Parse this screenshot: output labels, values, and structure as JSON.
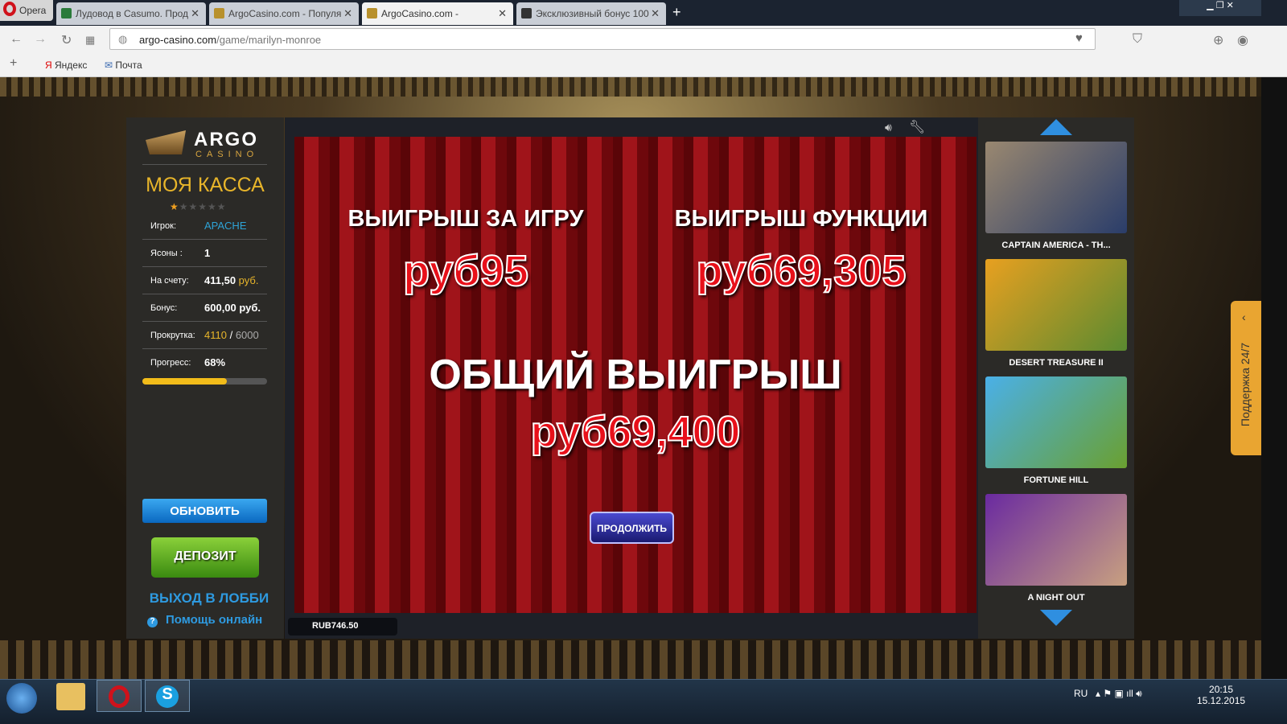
{
  "browser": {
    "opera_label": "Opera",
    "tabs": [
      {
        "title": "Лудовод в Casumo. Прод"
      },
      {
        "title": "ArgoCasino.com - Популя"
      },
      {
        "title": "ArgoCasino.com -"
      },
      {
        "title": "Эксклюзивный бонус 100"
      }
    ],
    "url_domain": "argo-casino.com",
    "url_path": "/game/marilyn-monroe",
    "bookmarks": [
      "Яндекс",
      "Почта"
    ]
  },
  "left": {
    "logo_top": "ARGO",
    "logo_bottom": "CASINO",
    "title": "МОЯ КАССА",
    "rating": 1,
    "rating_max": 6,
    "rows": [
      {
        "label": "Игрок:",
        "value": "APACHE"
      },
      {
        "label": "Ясоны :",
        "value": "1"
      },
      {
        "label": "На счету:",
        "value": "411,50",
        "unit": "руб."
      },
      {
        "label": "Бонус:",
        "value": "600,00 руб."
      },
      {
        "label": "Прокрутка:",
        "value": "4110",
        "sep": " / ",
        "total": "6000"
      },
      {
        "label": "Прогресс:",
        "value": "68%"
      }
    ],
    "progress": 0.68,
    "refresh": "ОБНОВИТЬ",
    "deposit": "ДЕПОЗИТ",
    "lobby": "ВЫХОД В ЛОББИ",
    "help": "Помощь онлайн"
  },
  "game": {
    "win_game_label": "ВЫИГРЫШ ЗА ИГРУ",
    "win_game": "руб95",
    "win_feature_label": "ВЫИГРЫШ ФУНКЦИИ",
    "win_feature": "руб69,305",
    "total_label": "ОБЩИЙ ВЫИГРЫШ",
    "total": "руб69,400",
    "continue": "ПРОДОЛЖИТЬ",
    "balance": "RUB746.50"
  },
  "games": [
    {
      "name": "CAPTAIN AMERICA - TH...",
      "colors": [
        "#9a8870",
        "#2a3d6a"
      ]
    },
    {
      "name": "DESERT TREASURE II",
      "colors": [
        "#e8a020",
        "#5a8a30"
      ]
    },
    {
      "name": "FORTUNE HILL",
      "colors": [
        "#4ab0e8",
        "#6aa030"
      ]
    },
    {
      "name": "A NIGHT OUT",
      "colors": [
        "#6a2aa0",
        "#c8a080"
      ]
    }
  ],
  "support": "Поддержка 24/7",
  "taskbar": {
    "lang": "RU",
    "time": "20:15",
    "date": "15.12.2015"
  }
}
